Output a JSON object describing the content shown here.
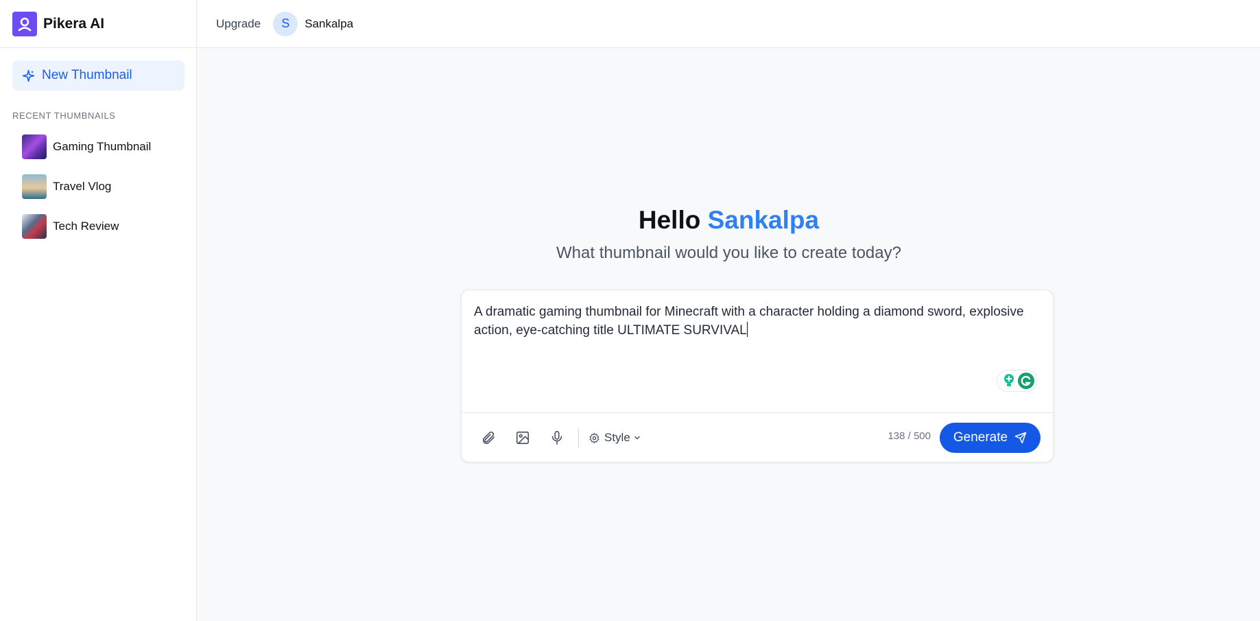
{
  "app": {
    "name": "Pikera AI"
  },
  "sidebar": {
    "new_button": "New Thumbnail",
    "recent_heading": "RECENT THUMBNAILS",
    "recent": [
      {
        "label": "Gaming Thumbnail"
      },
      {
        "label": "Travel Vlog"
      },
      {
        "label": "Tech Review"
      }
    ]
  },
  "topbar": {
    "upgrade": "Upgrade",
    "avatar_initial": "S",
    "username": "Sankalpa"
  },
  "hero": {
    "greeting": "Hello",
    "name": "Sankalpa",
    "subtitle": "What thumbnail would you like to create today?"
  },
  "composer": {
    "prompt": "A dramatic gaming thumbnail for Minecraft with a character holding a diamond sword, explosive action, eye-catching title ULTIMATE SURVIVAL",
    "style_label": "Style",
    "char_count": "138 / 500",
    "generate_label": "Generate"
  },
  "colors": {
    "accent": "#1558e6",
    "brand": "#6d4cf1",
    "name_highlight": "#2f80f0"
  }
}
